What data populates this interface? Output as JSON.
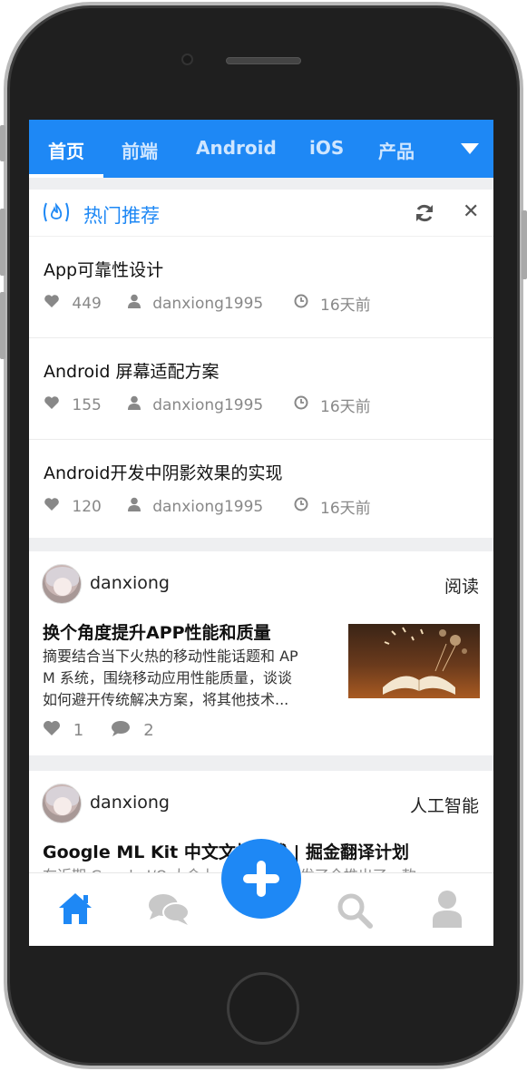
{
  "topnav": {
    "tabs": [
      {
        "label": "首页"
      },
      {
        "label": "前端"
      },
      {
        "label": "Android"
      },
      {
        "label": "iOS"
      },
      {
        "label": "产品"
      }
    ]
  },
  "hot": {
    "title": "热门推荐",
    "items": [
      {
        "title": "App可靠性设计",
        "likes": "449",
        "author": "danxiong1995",
        "time": "16天前"
      },
      {
        "title": "Android 屏幕适配方案",
        "likes": "155",
        "author": "danxiong1995",
        "time": "16天前"
      },
      {
        "title": "Android开发中阴影效果的实现",
        "likes": "120",
        "author": "danxiong1995",
        "time": "16天前"
      }
    ]
  },
  "feed": [
    {
      "author": "danxiong",
      "tag": "阅读",
      "title": "换个角度提升APP性能和质量",
      "excerpt_line1": "摘要结合当下火热的移动性能话题和 AP",
      "excerpt_line2": "M 系统，围绕移动应用性能质量，谈谈",
      "excerpt_line3": "如何避开传统解决方案，将其他技术...",
      "likes": "1",
      "comments": "2"
    },
    {
      "author": "danxiong",
      "tag": "人工智能",
      "title": "Google ML Kit 中文文档上线 | 掘金翻译计划",
      "excerpt_line1": "在近期 Google I/O 大会上，Google 开发了全推出了一款"
    }
  ],
  "colors": {
    "accent": "#1e88f5",
    "text": "#111111",
    "muted": "#888888"
  }
}
